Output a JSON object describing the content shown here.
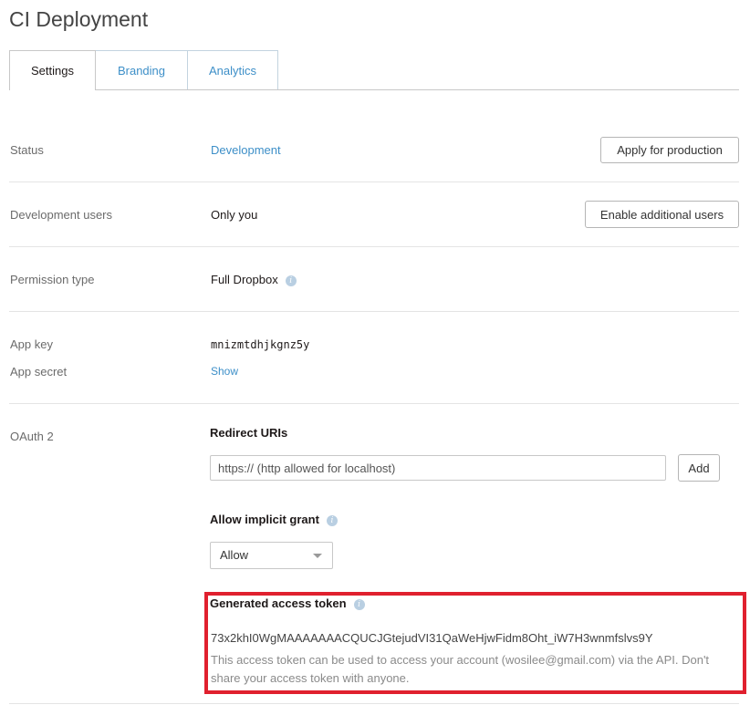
{
  "app": {
    "title": "CI Deployment"
  },
  "tabs": [
    {
      "label": "Settings",
      "active": true
    },
    {
      "label": "Branding",
      "active": false
    },
    {
      "label": "Analytics",
      "active": false
    }
  ],
  "status": {
    "label": "Status",
    "value": "Development",
    "button": "Apply for production"
  },
  "dev_users": {
    "label": "Development users",
    "value": "Only you",
    "button": "Enable additional users"
  },
  "permission": {
    "label": "Permission type",
    "value": "Full Dropbox",
    "icon": "info-icon"
  },
  "app_key": {
    "label": "App key",
    "value": "mnizmtdhjkgnz5y"
  },
  "app_secret": {
    "label": "App secret",
    "link": "Show"
  },
  "oauth": {
    "label": "OAuth 2",
    "redirect_heading": "Redirect URIs",
    "redirect_placeholder": "https:// (http allowed for localhost)",
    "add_button": "Add",
    "implicit_heading": "Allow implicit grant",
    "implicit_selected": "Allow",
    "token_heading": "Generated access token",
    "token_value": "73x2khI0WgMAAAAAAACQUCJGtejudVI31QaWeHjwFidm8Oht_iW7H3wnmfslvs9Y",
    "token_note": "This access token can be used to access your account (wosilee@gmail.com) via the API. Don't share your access token with anyone."
  },
  "colors": {
    "link": "#3d8fc8",
    "highlight": "#e0202e",
    "info_icon": "#b9cfe2"
  }
}
